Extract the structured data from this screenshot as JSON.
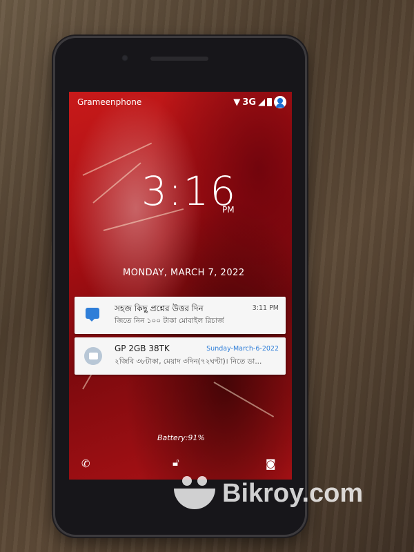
{
  "status_bar": {
    "carrier": "Grameenphone",
    "network": "3G"
  },
  "lock_screen": {
    "time": "3:16",
    "ampm": "PM",
    "date": "MONDAY, MARCH 7, 2022",
    "battery": "Battery:91%"
  },
  "notifications": [
    {
      "title": "সহজ কিছু প্রশ্নের উত্তর দিন",
      "body": "জিতে নিন ১০০ টাকা মোবাইল রিচার্জ",
      "time": "3:11 PM",
      "icon": "chat-icon"
    },
    {
      "title": "GP 2GB 38TK",
      "body": "২জিবি ৩৮টাকা, মেয়াদ ৩দিন(৭২ঘণ্টা)। নিতে ডা...",
      "time": "Sunday-March-6-2022",
      "icon": "sms-icon"
    }
  ],
  "watermark": "Bikroy.com",
  "colors": {
    "wallpaper_red": "#b01216",
    "notification_bg": "#f6f6f6",
    "accent_blue": "#2f7ed8"
  }
}
